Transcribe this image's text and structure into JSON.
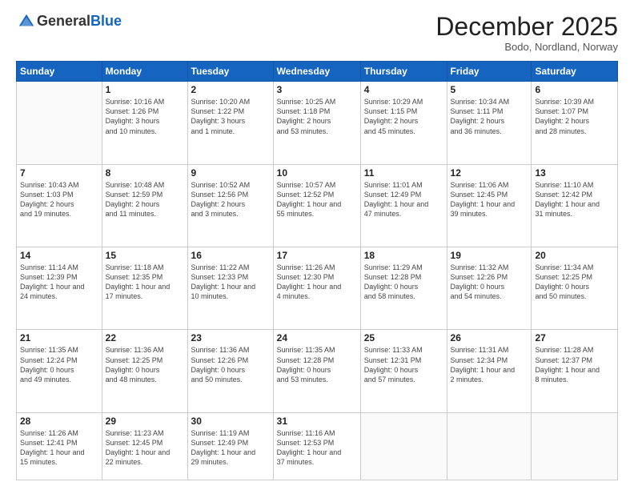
{
  "logo": {
    "general": "General",
    "blue": "Blue"
  },
  "header": {
    "month": "December 2025",
    "location": "Bodo, Nordland, Norway"
  },
  "weekdays": [
    "Sunday",
    "Monday",
    "Tuesday",
    "Wednesday",
    "Thursday",
    "Friday",
    "Saturday"
  ],
  "weeks": [
    [
      {
        "day": "",
        "info": ""
      },
      {
        "day": "1",
        "info": "Sunrise: 10:16 AM\nSunset: 1:26 PM\nDaylight: 3 hours\nand 10 minutes."
      },
      {
        "day": "2",
        "info": "Sunrise: 10:20 AM\nSunset: 1:22 PM\nDaylight: 3 hours\nand 1 minute."
      },
      {
        "day": "3",
        "info": "Sunrise: 10:25 AM\nSunset: 1:18 PM\nDaylight: 2 hours\nand 53 minutes."
      },
      {
        "day": "4",
        "info": "Sunrise: 10:29 AM\nSunset: 1:15 PM\nDaylight: 2 hours\nand 45 minutes."
      },
      {
        "day": "5",
        "info": "Sunrise: 10:34 AM\nSunset: 1:11 PM\nDaylight: 2 hours\nand 36 minutes."
      },
      {
        "day": "6",
        "info": "Sunrise: 10:39 AM\nSunset: 1:07 PM\nDaylight: 2 hours\nand 28 minutes."
      }
    ],
    [
      {
        "day": "7",
        "info": "Sunrise: 10:43 AM\nSunset: 1:03 PM\nDaylight: 2 hours\nand 19 minutes."
      },
      {
        "day": "8",
        "info": "Sunrise: 10:48 AM\nSunset: 12:59 PM\nDaylight: 2 hours\nand 11 minutes."
      },
      {
        "day": "9",
        "info": "Sunrise: 10:52 AM\nSunset: 12:56 PM\nDaylight: 2 hours\nand 3 minutes."
      },
      {
        "day": "10",
        "info": "Sunrise: 10:57 AM\nSunset: 12:52 PM\nDaylight: 1 hour and\n55 minutes."
      },
      {
        "day": "11",
        "info": "Sunrise: 11:01 AM\nSunset: 12:49 PM\nDaylight: 1 hour and\n47 minutes."
      },
      {
        "day": "12",
        "info": "Sunrise: 11:06 AM\nSunset: 12:45 PM\nDaylight: 1 hour and\n39 minutes."
      },
      {
        "day": "13",
        "info": "Sunrise: 11:10 AM\nSunset: 12:42 PM\nDaylight: 1 hour and\n31 minutes."
      }
    ],
    [
      {
        "day": "14",
        "info": "Sunrise: 11:14 AM\nSunset: 12:39 PM\nDaylight: 1 hour and\n24 minutes."
      },
      {
        "day": "15",
        "info": "Sunrise: 11:18 AM\nSunset: 12:35 PM\nDaylight: 1 hour and\n17 minutes."
      },
      {
        "day": "16",
        "info": "Sunrise: 11:22 AM\nSunset: 12:33 PM\nDaylight: 1 hour and\n10 minutes."
      },
      {
        "day": "17",
        "info": "Sunrise: 11:26 AM\nSunset: 12:30 PM\nDaylight: 1 hour and\n4 minutes."
      },
      {
        "day": "18",
        "info": "Sunrise: 11:29 AM\nSunset: 12:28 PM\nDaylight: 0 hours\nand 58 minutes."
      },
      {
        "day": "19",
        "info": "Sunrise: 11:32 AM\nSunset: 12:26 PM\nDaylight: 0 hours\nand 54 minutes."
      },
      {
        "day": "20",
        "info": "Sunrise: 11:34 AM\nSunset: 12:25 PM\nDaylight: 0 hours\nand 50 minutes."
      }
    ],
    [
      {
        "day": "21",
        "info": "Sunrise: 11:35 AM\nSunset: 12:24 PM\nDaylight: 0 hours\nand 49 minutes."
      },
      {
        "day": "22",
        "info": "Sunrise: 11:36 AM\nSunset: 12:25 PM\nDaylight: 0 hours\nand 48 minutes."
      },
      {
        "day": "23",
        "info": "Sunrise: 11:36 AM\nSunset: 12:26 PM\nDaylight: 0 hours\nand 50 minutes."
      },
      {
        "day": "24",
        "info": "Sunrise: 11:35 AM\nSunset: 12:28 PM\nDaylight: 0 hours\nand 53 minutes."
      },
      {
        "day": "25",
        "info": "Sunrise: 11:33 AM\nSunset: 12:31 PM\nDaylight: 0 hours\nand 57 minutes."
      },
      {
        "day": "26",
        "info": "Sunrise: 11:31 AM\nSunset: 12:34 PM\nDaylight: 1 hour and\n2 minutes."
      },
      {
        "day": "27",
        "info": "Sunrise: 11:28 AM\nSunset: 12:37 PM\nDaylight: 1 hour and\n8 minutes."
      }
    ],
    [
      {
        "day": "28",
        "info": "Sunrise: 11:26 AM\nSunset: 12:41 PM\nDaylight: 1 hour and\n15 minutes."
      },
      {
        "day": "29",
        "info": "Sunrise: 11:23 AM\nSunset: 12:45 PM\nDaylight: 1 hour and\n22 minutes."
      },
      {
        "day": "30",
        "info": "Sunrise: 11:19 AM\nSunset: 12:49 PM\nDaylight: 1 hour and\n29 minutes."
      },
      {
        "day": "31",
        "info": "Sunrise: 11:16 AM\nSunset: 12:53 PM\nDaylight: 1 hour and\n37 minutes."
      },
      {
        "day": "",
        "info": ""
      },
      {
        "day": "",
        "info": ""
      },
      {
        "day": "",
        "info": ""
      }
    ]
  ]
}
